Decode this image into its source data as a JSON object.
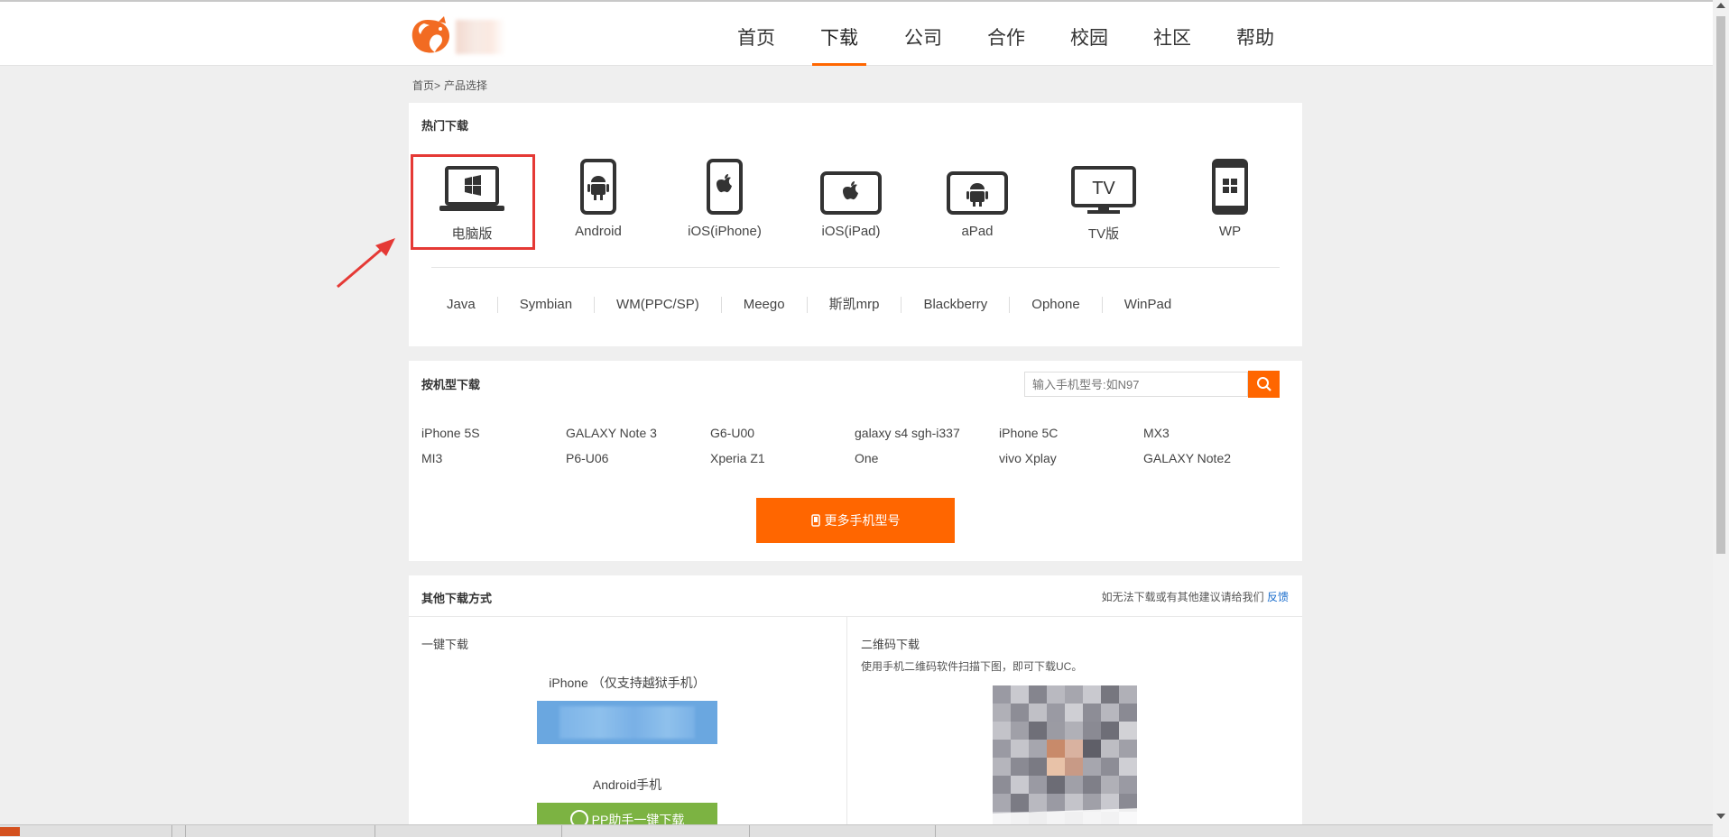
{
  "nav": {
    "items": [
      "首页",
      "下载",
      "公司",
      "合作",
      "校园",
      "社区",
      "帮助"
    ],
    "active": "下载"
  },
  "breadcrumb": {
    "home": "首页>",
    "current": "产品选择"
  },
  "hot": {
    "title": "热门下载",
    "platforms": [
      "电脑版",
      "Android",
      "iOS(iPhone)",
      "iOS(iPad)",
      "aPad",
      "TV版",
      "WP"
    ],
    "tv_icon_text": "TV",
    "other_os": [
      "Java",
      "Symbian",
      "WM(PPC/SP)",
      "Meego",
      "斯凯mrp",
      "Blackberry",
      "Ophone",
      "WinPad"
    ]
  },
  "models": {
    "title": "按机型下载",
    "search_placeholder": "输入手机型号:如N97",
    "list": [
      "iPhone 5S",
      "GALAXY Note 3",
      "G6-U00",
      "galaxy s4 sgh-i337",
      "iPhone 5C",
      "MX3",
      "MI3",
      "P6-U06",
      "Xperia Z1",
      "One",
      "vivo Xplay",
      "GALAXY Note2"
    ],
    "more_button": "更多手机型号"
  },
  "other": {
    "title": "其他下载方式",
    "feedback_text": "如无法下载或有其他建议请给我们",
    "feedback_link": "反馈",
    "one_click_title": "一键下载",
    "iphone_label": "iPhone （仅支持越狱手机）",
    "android_label": "Android手机",
    "android_button": "PP助手一键下载",
    "qr_title": "二维码下载",
    "qr_desc": "使用手机二维码软件扫描下图，即可下载UC。"
  },
  "colors": {
    "accent": "#ff6600",
    "highlight": "#e53935"
  }
}
